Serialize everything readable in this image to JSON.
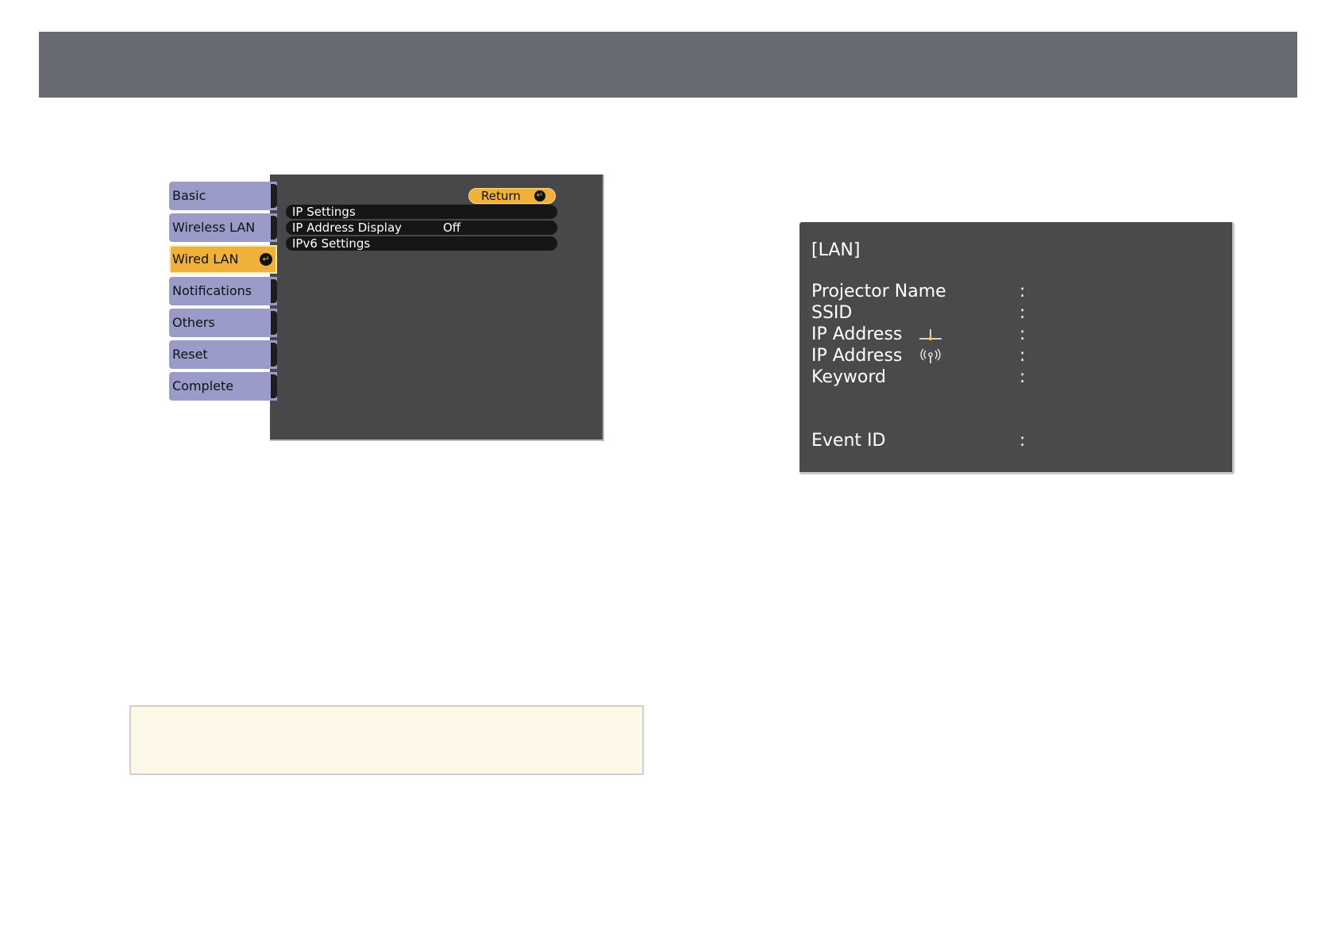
{
  "menu": {
    "tabs": [
      {
        "label": "Basic",
        "active": false
      },
      {
        "label": "Wireless LAN",
        "active": false
      },
      {
        "label": "Wired LAN",
        "active": true
      },
      {
        "label": "Notifications",
        "active": false
      },
      {
        "label": "Others",
        "active": false
      },
      {
        "label": "Reset",
        "active": false
      },
      {
        "label": "Complete",
        "active": false
      }
    ],
    "return_label": "Return",
    "items": [
      {
        "label": "IP Settings",
        "value": ""
      },
      {
        "label": "IP Address Display",
        "value": "Off"
      },
      {
        "label": "IPv6 Settings",
        "value": ""
      }
    ]
  },
  "lan_screen": {
    "title": "[LAN]",
    "rows": [
      {
        "label": "Projector Name",
        "colon": ":"
      },
      {
        "label": "SSID",
        "colon": ":"
      },
      {
        "label": "IP Address",
        "colon": ":",
        "icon": "wired-lan-icon"
      },
      {
        "label": "IP Address",
        "colon": ":",
        "icon": "wireless-lan-icon"
      },
      {
        "label": "Keyword",
        "colon": ":"
      },
      {
        "label": "Event ID",
        "colon": ":"
      }
    ]
  },
  "colors": {
    "header_bar": "#686a72",
    "tab_inactive": "#9b9bc9",
    "tab_active": "#f0b13a",
    "panel_bg": "#48484a",
    "note_bg": "#fdf8e8"
  }
}
